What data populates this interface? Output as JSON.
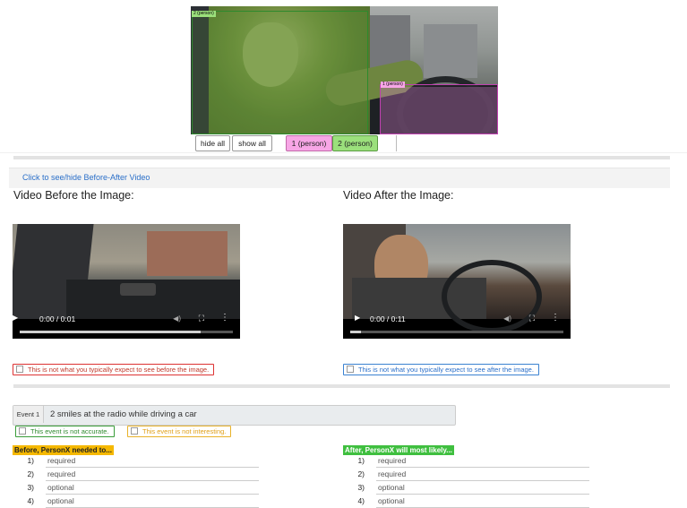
{
  "image": {
    "box_labels": {
      "person1": "1 (person)",
      "person2": "2 (person)"
    },
    "controls": {
      "hide_all": "hide all",
      "show_all": "show all",
      "person1": "1 (person)",
      "person2": "2 (person)"
    },
    "colors": {
      "person1": "#f7a6e6",
      "person2": "#9be07c"
    }
  },
  "toggle_link": "Click to see/hide Before-After Video",
  "before_video": {
    "heading": "Video Before the Image:",
    "time": "0:00 / 0:01",
    "progress": 0.85,
    "checkbox": "This is not what you typically expect to see before the image."
  },
  "after_video": {
    "heading": "Video After the Image:",
    "time": "0:00 / 0:11",
    "progress": 0.05,
    "checkbox": "This is not what you typically expect to see after the image."
  },
  "event": {
    "label": "Event 1",
    "text": "2 smiles at the radio while driving a car",
    "not_accurate": "This event is not accurate.",
    "not_interesting": "This event is not interesting."
  },
  "before": {
    "title": "Before, PersonX needed to...",
    "items": [
      {
        "num": "1)",
        "value": "required"
      },
      {
        "num": "2)",
        "value": "required"
      },
      {
        "num": "3)",
        "value": "optional"
      },
      {
        "num": "4)",
        "value": "optional"
      }
    ]
  },
  "after": {
    "title": "After, PersonX will most likely...",
    "items": [
      {
        "num": "1)",
        "value": "required"
      },
      {
        "num": "2)",
        "value": "required"
      },
      {
        "num": "3)",
        "value": "optional"
      },
      {
        "num": "4)",
        "value": "optional"
      }
    ]
  }
}
